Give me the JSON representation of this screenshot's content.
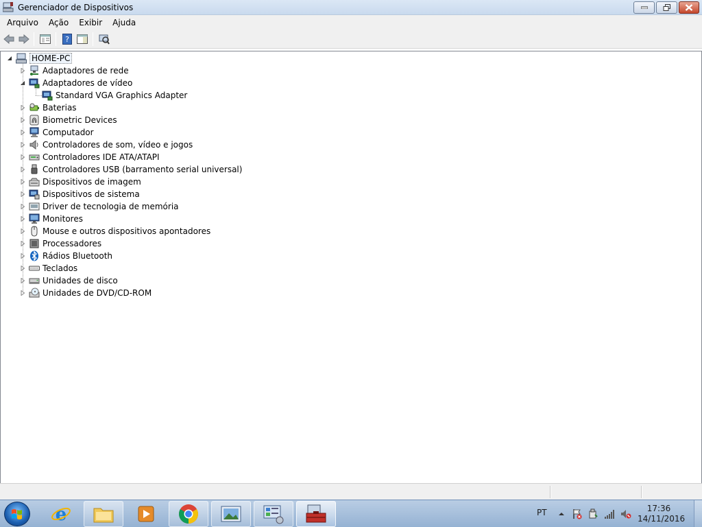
{
  "window": {
    "title": "Gerenciador de Dispositivos"
  },
  "menu": [
    "Arquivo",
    "Ação",
    "Exibir",
    "Ajuda"
  ],
  "toolbar": {
    "buttons": [
      "back-icon",
      "forward-icon",
      "properties-view-icon",
      "help-icon",
      "panel-icon",
      "scan-hardware-icon"
    ]
  },
  "tree": {
    "root": "HOME-PC",
    "categories": [
      {
        "label": "Adaptadores de rede",
        "icon": "network-adapter-icon",
        "expanded": false
      },
      {
        "label": "Adaptadores de vídeo",
        "icon": "display-adapter-icon",
        "expanded": true,
        "children": [
          {
            "label": "Standard VGA Graphics Adapter",
            "icon": "display-adapter-icon"
          }
        ]
      },
      {
        "label": "Baterias",
        "icon": "battery-icon",
        "expanded": false
      },
      {
        "label": "Biometric Devices",
        "icon": "fingerprint-icon",
        "expanded": false
      },
      {
        "label": "Computador",
        "icon": "computer-icon",
        "expanded": false
      },
      {
        "label": "Controladores de som, vídeo e jogos",
        "icon": "speaker-icon",
        "expanded": false
      },
      {
        "label": "Controladores IDE ATA/ATAPI",
        "icon": "ide-controller-icon",
        "expanded": false
      },
      {
        "label": "Controladores USB (barramento serial universal)",
        "icon": "usb-icon",
        "expanded": false
      },
      {
        "label": "Dispositivos de imagem",
        "icon": "imaging-device-icon",
        "expanded": false
      },
      {
        "label": "Dispositivos de sistema",
        "icon": "system-device-icon",
        "expanded": false
      },
      {
        "label": "Driver de tecnologia de memória",
        "icon": "memory-icon",
        "expanded": false
      },
      {
        "label": "Monitores",
        "icon": "monitor-icon",
        "expanded": false
      },
      {
        "label": "Mouse e outros dispositivos apontadores",
        "icon": "mouse-icon",
        "expanded": false
      },
      {
        "label": "Processadores",
        "icon": "processor-icon",
        "expanded": false
      },
      {
        "label": "Rádios Bluetooth",
        "icon": "bluetooth-icon",
        "expanded": false
      },
      {
        "label": "Teclados",
        "icon": "keyboard-icon",
        "expanded": false
      },
      {
        "label": "Unidades de disco",
        "icon": "disk-drive-icon",
        "expanded": false
      },
      {
        "label": "Unidades de DVD/CD-ROM",
        "icon": "dvd-drive-icon",
        "expanded": false
      }
    ]
  },
  "taskbar": {
    "apps": [
      "internet-explorer-icon",
      "file-explorer-icon",
      "media-player-icon",
      "chrome-icon",
      "photo-viewer-icon",
      "control-panel-icon",
      "device-manager-icon"
    ],
    "language": "PT",
    "time": "17:36",
    "date": "14/11/2016"
  }
}
